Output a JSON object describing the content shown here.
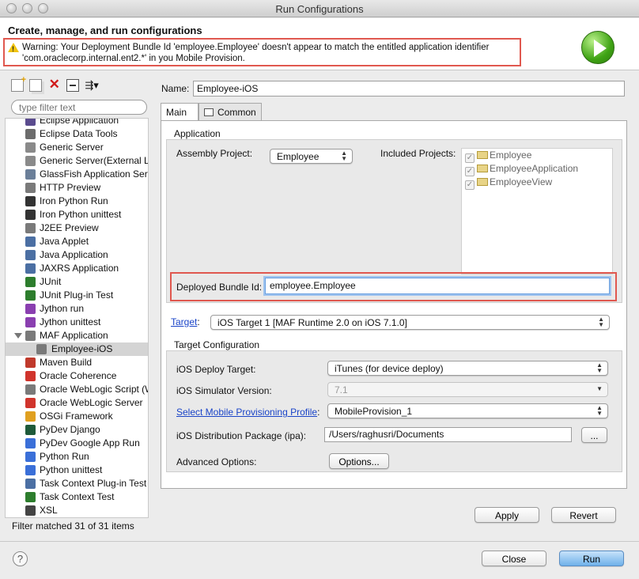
{
  "window": {
    "title": "Run Configurations"
  },
  "header": {
    "title": "Create, manage, and run configurations",
    "warning_line1": "Warning: Your Deployment Bundle Id 'employee.Employee' doesn't appear to match the entitled application identifier",
    "warning_line2": "'com.oraclecorp.internal.ent2.*' in you Mobile Provision."
  },
  "left": {
    "filter_placeholder": "type filter text",
    "items": [
      {
        "label": "Eclipse Application",
        "icon": "eclipse-icon",
        "color": "#5a4b8e"
      },
      {
        "label": "Eclipse Data Tools",
        "icon": "data-tools-icon",
        "color": "#6b6b6b"
      },
      {
        "label": "Generic Server",
        "icon": "server-icon",
        "color": "#8a8a8a"
      },
      {
        "label": "Generic Server(External La",
        "icon": "server-icon",
        "color": "#8a8a8a"
      },
      {
        "label": "GlassFish Application Serv",
        "icon": "glassfish-icon",
        "color": "#6b7f99"
      },
      {
        "label": "HTTP Preview",
        "icon": "http-icon",
        "color": "#7a7a7a"
      },
      {
        "label": "Iron Python Run",
        "icon": "python-icon",
        "color": "#333333"
      },
      {
        "label": "Iron Python unittest",
        "icon": "python-test-icon",
        "color": "#333333"
      },
      {
        "label": "J2EE Preview",
        "icon": "j2ee-icon",
        "color": "#7a7a7a"
      },
      {
        "label": "Java Applet",
        "icon": "applet-icon",
        "color": "#4b6fa3"
      },
      {
        "label": "Java Application",
        "icon": "java-app-icon",
        "color": "#4b6fa3"
      },
      {
        "label": "JAXRS Application",
        "icon": "jaxrs-icon",
        "color": "#4b6fa3"
      },
      {
        "label": "JUnit",
        "icon": "junit-icon",
        "color": "#2d7d2d"
      },
      {
        "label": "JUnit Plug-in Test",
        "icon": "junit-plugin-icon",
        "color": "#2d7d2d"
      },
      {
        "label": "Jython run",
        "icon": "jython-icon",
        "color": "#8a3fb0"
      },
      {
        "label": "Jython unittest",
        "icon": "jython-test-icon",
        "color": "#8a3fb0"
      },
      {
        "label": "MAF Application",
        "icon": "maf-icon",
        "color": "#7a7a7a"
      },
      {
        "label": "Employee-iOS",
        "icon": "config-icon",
        "color": "#7a7a7a"
      },
      {
        "label": "Maven Build",
        "icon": "maven-icon",
        "color": "#c0392b"
      },
      {
        "label": "Oracle Coherence",
        "icon": "coherence-icon",
        "color": "#d0342c"
      },
      {
        "label": "Oracle WebLogic Script (W",
        "icon": "weblogic-script-icon",
        "color": "#7a7a7a"
      },
      {
        "label": "Oracle WebLogic Server",
        "icon": "weblogic-icon",
        "color": "#d0342c"
      },
      {
        "label": "OSGi Framework",
        "icon": "osgi-icon",
        "color": "#e0a020"
      },
      {
        "label": "PyDev Django",
        "icon": "django-icon",
        "color": "#1e5a3a"
      },
      {
        "label": "PyDev Google App Run",
        "icon": "google-app-icon",
        "color": "#3a6fd8"
      },
      {
        "label": "Python Run",
        "icon": "python-run-icon",
        "color": "#3a6fd8"
      },
      {
        "label": "Python unittest",
        "icon": "python-unittest-icon",
        "color": "#3a6fd8"
      },
      {
        "label": "Task Context Plug-in Test",
        "icon": "task-context-icon",
        "color": "#4b6fa3"
      },
      {
        "label": "Task Context Test",
        "icon": "task-test-icon",
        "color": "#2d7d2d"
      },
      {
        "label": "XSL",
        "icon": "xsl-icon",
        "color": "#444444"
      }
    ],
    "status": "Filter matched 31 of 31 items"
  },
  "right": {
    "name_label": "Name:",
    "name_value": "Employee-iOS",
    "tab_main": "Main",
    "tab_common": "Common",
    "application_group": "Application",
    "assembly_label": "Assembly Project:",
    "assembly_value": "Employee",
    "included_label": "Included Projects:",
    "included": [
      "Employee",
      "EmployeeApplication",
      "EmployeeView"
    ],
    "bundle_label": "Deployed Bundle Id:",
    "bundle_value": "employee.Employee",
    "target_label": "Target",
    "target_colon": ":",
    "target_value": "iOS Target 1 [MAF Runtime 2.0 on iOS 7.1.0]",
    "target_config_group": "Target Configuration",
    "deploy_target_label": "iOS Deploy Target:",
    "deploy_target_value": "iTunes (for device deploy)",
    "simulator_label": "iOS Simulator Version:",
    "simulator_value": "7.1",
    "provisioning_label": "Select Mobile Provisioning Profile",
    "provisioning_colon": ":",
    "provisioning_value": "MobileProvision_1",
    "package_label": "iOS Distribution Package (ipa):",
    "package_value": "/Users/raghusri/Documents",
    "browse_label": "...",
    "advanced_label": "Advanced Options:",
    "options_button": "Options...",
    "apply": "Apply",
    "revert": "Revert"
  },
  "footer": {
    "help": "?",
    "close": "Close",
    "run": "Run"
  }
}
